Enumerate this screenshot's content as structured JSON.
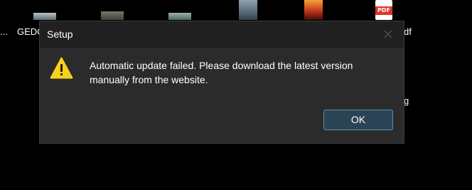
{
  "desktop": {
    "icons": [
      {
        "label": "...",
        "icon": "image-thumbnail"
      },
      {
        "label": "GEDC",
        "icon": "image-thumbnail"
      },
      {
        "label": "",
        "icon": "image-thumbnail"
      },
      {
        "label": "",
        "icon": "image-thumbnail"
      },
      {
        "label": "",
        "icon": "image-thumbnail"
      },
      {
        "label": "",
        "icon": "image-thumbnail"
      },
      {
        "label": "df",
        "icon": "pdf-file-icon"
      },
      {
        "label": "g",
        "icon": "file-icon"
      }
    ],
    "pdf_badge": "PDF"
  },
  "dialog": {
    "title": "Setup",
    "close_icon": "close-icon",
    "icon": "warning-icon",
    "message": "Automatic update failed. Please download the latest version manually from the website.",
    "ok_label": "OK",
    "colors": {
      "background": "#2b2b2b",
      "titlebar": "#202020",
      "button_fill": "#2b4455",
      "button_border": "#5f8aa6",
      "warning": "#f7d21c"
    }
  }
}
